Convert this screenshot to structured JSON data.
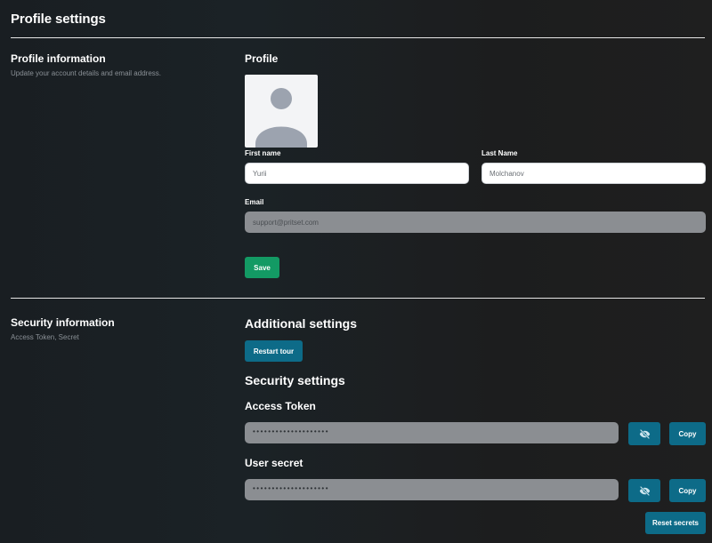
{
  "header": {
    "title": "Profile settings"
  },
  "profile_section": {
    "title": "Profile information",
    "subtitle": "Update your account details and email address.",
    "heading": "Profile",
    "first_name": {
      "label": "First name",
      "value": "Yurii"
    },
    "last_name": {
      "label": "Last Name",
      "value": "Molchanov"
    },
    "email": {
      "label": "Email",
      "value": "support@pritset.com"
    },
    "save_label": "Save"
  },
  "security_section": {
    "title": "Security information",
    "subtitle": "Access Token, Secret",
    "additional_heading": "Additional settings",
    "restart_tour_label": "Restart tour",
    "security_heading": "Security settings",
    "access_token": {
      "label": "Access Token",
      "masked_value": "••••••••••••••••••••",
      "copy_label": "Copy"
    },
    "user_secret": {
      "label": "User secret",
      "masked_value": "••••••••••••••••••••",
      "copy_label": "Copy"
    },
    "reset_label": "Reset secrets"
  },
  "icons": {
    "avatar": "avatar-placeholder-icon",
    "visibility": "eye-off-icon"
  },
  "colors": {
    "background": "#1b2226",
    "save_button": "#139a64",
    "teal_button": "#0d6b88",
    "disabled_field": "#8b8e92"
  }
}
